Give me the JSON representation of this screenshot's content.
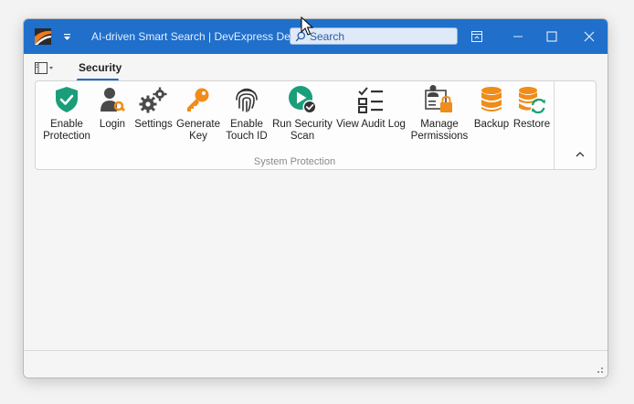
{
  "titlebar": {
    "title": "AI-driven Smart Search | DevExpress Demo",
    "search_placeholder": "Search",
    "color": "#1f6fcb"
  },
  "tabs": [
    {
      "label": "Security",
      "active": true
    }
  ],
  "ribbon": {
    "group_label": "System Protection",
    "buttons": [
      {
        "label": "Enable Protection",
        "icon": "shield-check-icon",
        "color": "#1a9e7a"
      },
      {
        "label": "Login",
        "icon": "user-key-icon",
        "color": "#444444"
      },
      {
        "label": "Settings",
        "icon": "gears-icon",
        "color": "#444444"
      },
      {
        "label": "Generate Key",
        "icon": "key-icon",
        "color": "#f08c1a"
      },
      {
        "label": "Enable Touch ID",
        "icon": "fingerprint-icon",
        "color": "#333333"
      },
      {
        "label": "Run Security Scan",
        "icon": "play-check-icon",
        "color": "#1a9e7a"
      },
      {
        "label": "View Audit Log",
        "icon": "checklist-icon",
        "color": "#333333"
      },
      {
        "label": "Manage Permissions",
        "icon": "user-lock-icon",
        "color": "#f08c1a"
      },
      {
        "label": "Backup",
        "icon": "database-icon",
        "color": "#f08c1a"
      },
      {
        "label": "Restore",
        "icon": "database-restore-icon",
        "color": "#1a9e7a"
      }
    ]
  }
}
